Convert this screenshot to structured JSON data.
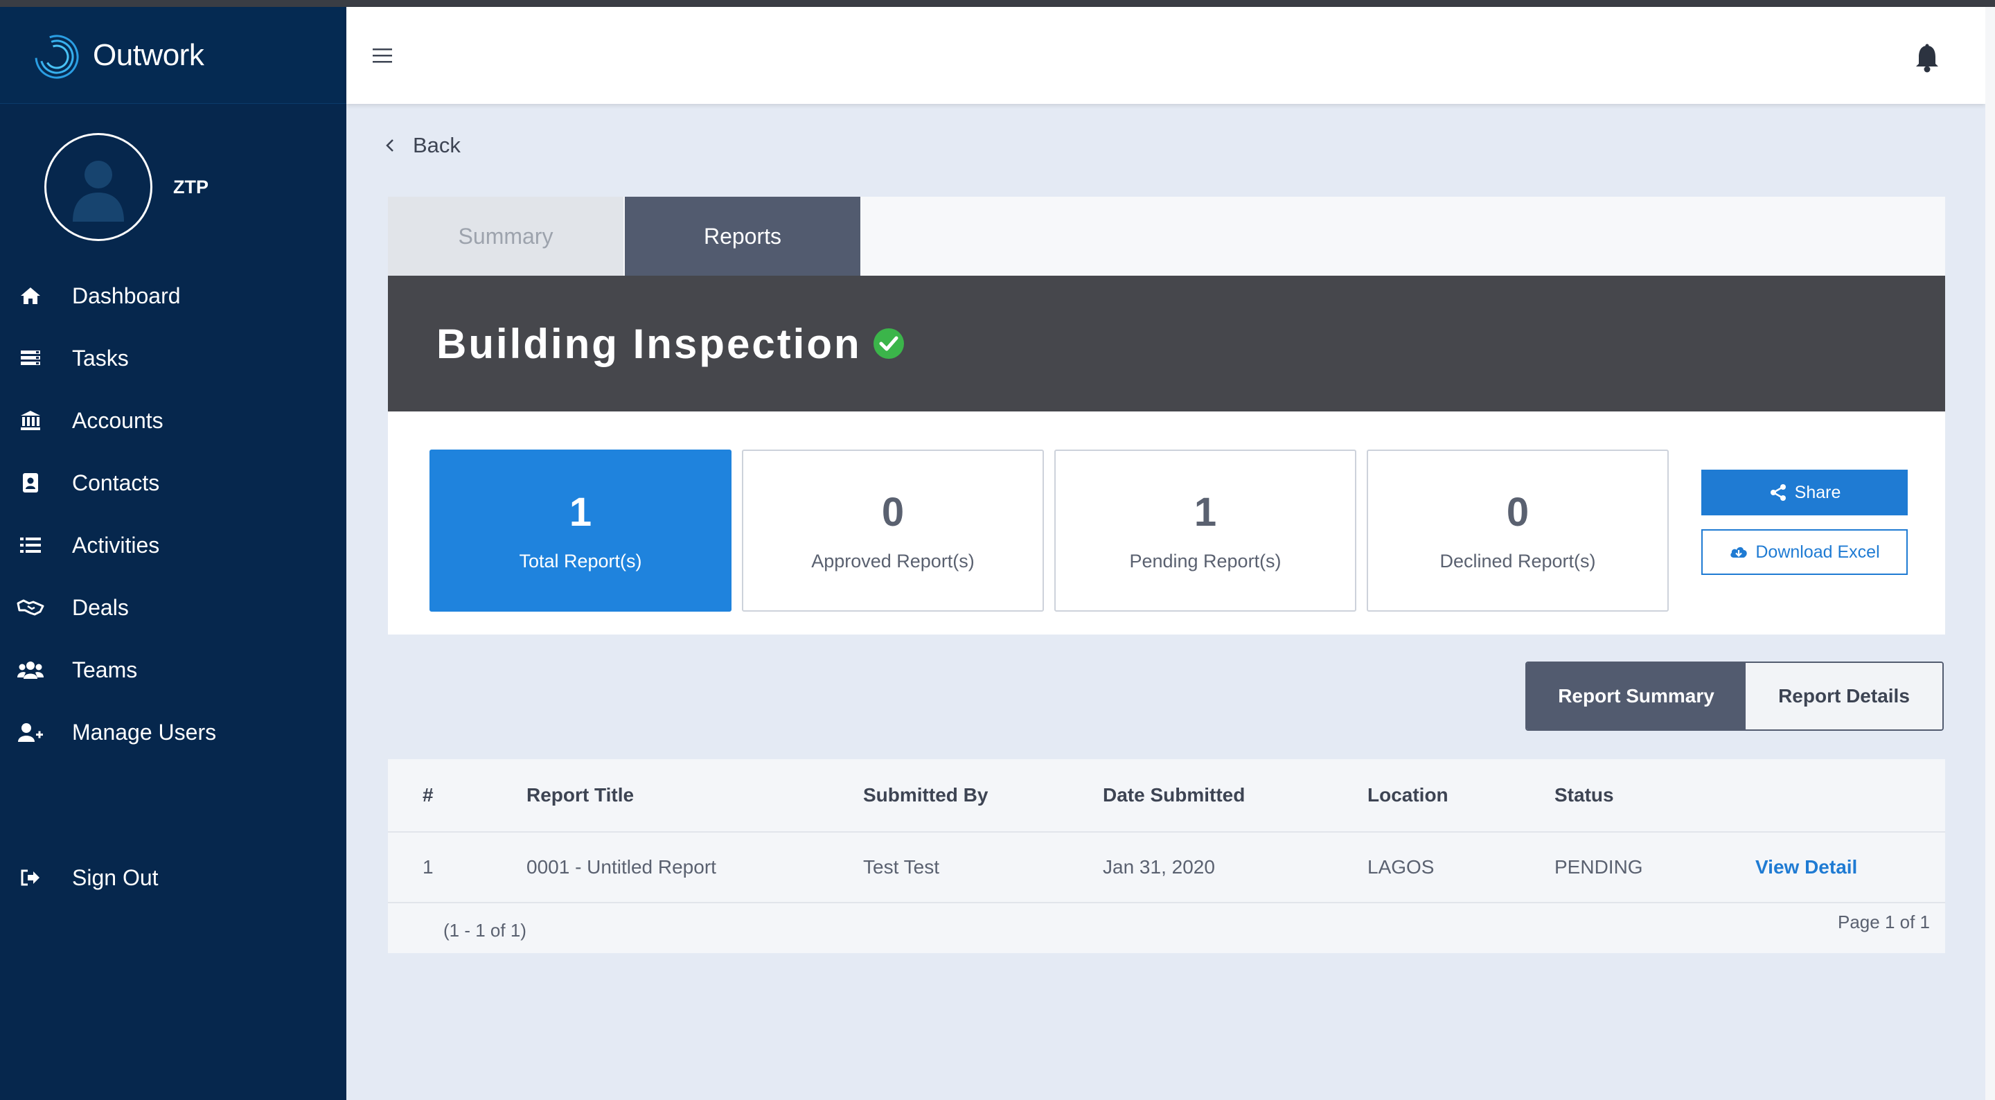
{
  "app": {
    "name": "Outwork",
    "user": "ZTP"
  },
  "sidebar": {
    "items": [
      {
        "label": "Dashboard",
        "icon": "home-icon"
      },
      {
        "label": "Tasks",
        "icon": "tasks-icon"
      },
      {
        "label": "Accounts",
        "icon": "bank-icon"
      },
      {
        "label": "Contacts",
        "icon": "contact-book-icon"
      },
      {
        "label": "Activities",
        "icon": "list-icon"
      },
      {
        "label": "Deals",
        "icon": "handshake-icon"
      },
      {
        "label": "Teams",
        "icon": "users-icon"
      },
      {
        "label": "Manage Users",
        "icon": "user-plus-icon"
      }
    ],
    "signout": {
      "label": "Sign Out",
      "icon": "sign-out-icon"
    }
  },
  "header": {
    "menu_icon": "hamburger-icon",
    "notification_icon": "bell-icon"
  },
  "back_label": "Back",
  "tabs": {
    "summary": "Summary",
    "reports": "Reports",
    "active": "Reports"
  },
  "banner": {
    "title": "Building Inspection",
    "verified_icon": "check-circle-icon"
  },
  "stats": [
    {
      "value": "1",
      "label": "Total Report(s)",
      "active": true
    },
    {
      "value": "0",
      "label": "Approved Report(s)",
      "active": false
    },
    {
      "value": "1",
      "label": "Pending Report(s)",
      "active": false
    },
    {
      "value": "0",
      "label": "Declined Report(s)",
      "active": false
    }
  ],
  "actions": {
    "share": "Share",
    "download": "Download Excel"
  },
  "view_toggle": {
    "summary": "Report Summary",
    "details": "Report Details",
    "active": "Report Summary"
  },
  "table": {
    "columns": [
      "#",
      "Report Title",
      "Submitted By",
      "Date Submitted",
      "Location",
      "Status"
    ],
    "rows": [
      {
        "num": "1",
        "title": "0001 - Untitled Report",
        "submitted_by": "Test Test",
        "date": "Jan 31, 2020",
        "location": "LAGOS",
        "status": "PENDING",
        "action": "View Detail"
      }
    ],
    "range": "(1 - 1 of 1)",
    "pagination": "Page 1 of 1"
  },
  "colors": {
    "sidebar_bg": "#06274d",
    "accent": "#1f83dd",
    "tab_active": "#525b6f",
    "banner_bg": "#46474c",
    "success": "#3bb54a"
  }
}
